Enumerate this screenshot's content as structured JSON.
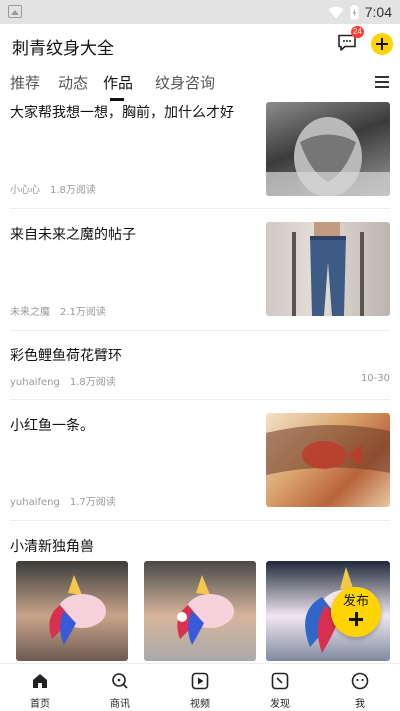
{
  "status_bar": {
    "time": "7:04",
    "icons": [
      "gallery-icon",
      "wifi-icon",
      "battery-charging-icon"
    ]
  },
  "app_bar": {
    "title": "刺青纹身大全",
    "message_badge": "24",
    "icons": [
      "message-icon",
      "add-icon"
    ]
  },
  "tabs": [
    {
      "label": "推荐",
      "active": false
    },
    {
      "label": "动态",
      "active": false
    },
    {
      "label": "作品",
      "active": true
    },
    {
      "label": "纹身咨询",
      "active": false
    }
  ],
  "posts": [
    {
      "title": "大家帮我想一想，胸前，加什么才好",
      "author": "小心心",
      "reads": "1.8万阅读",
      "thumbnail": "chest-tattoo-photo"
    },
    {
      "title": "来自未来之魔的帖子",
      "author": "未来之魔",
      "reads": "2.1万阅读",
      "thumbnail": "jeans-photo"
    },
    {
      "title": "彩色鲤鱼荷花臂环",
      "author": "yuhaifeng",
      "reads": "1.8万阅读",
      "date": "10-30"
    },
    {
      "title": "小红鱼一条。",
      "author": "yuhaifeng",
      "reads": "1.7万阅读",
      "thumbnail": "red-fish-armband-photo"
    },
    {
      "title": "小清新独角兽",
      "images": [
        "unicorn-tattoo-photo-1",
        "unicorn-tattoo-photo-2",
        "unicorn-tattoo-photo-3"
      ]
    }
  ],
  "fab": {
    "label": "发布"
  },
  "bottom_nav": [
    {
      "label": "首页",
      "icon": "home-icon",
      "active": true
    },
    {
      "label": "商讯",
      "icon": "search-icon",
      "active": false
    },
    {
      "label": "视频",
      "icon": "video-icon",
      "active": false
    },
    {
      "label": "发现",
      "icon": "discover-icon",
      "active": false
    },
    {
      "label": "我",
      "icon": "profile-icon",
      "active": false
    }
  ],
  "colors": {
    "accent": "#ffd400",
    "badge": "#ff3b30",
    "meta_text": "#999999",
    "status_bar": "#e3e3e3"
  }
}
